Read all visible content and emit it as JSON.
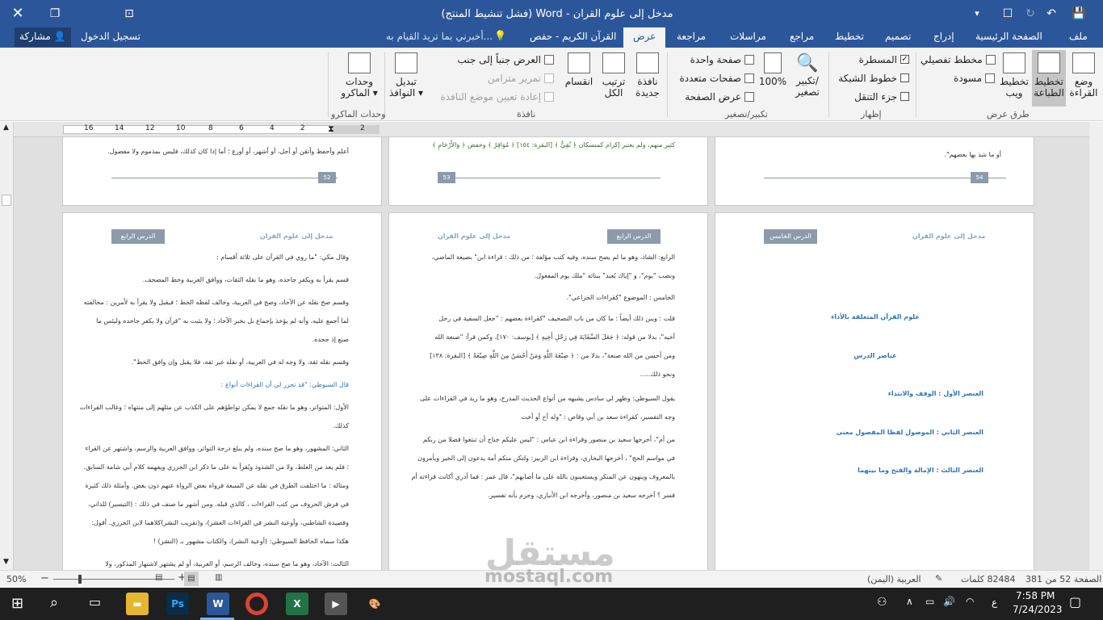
{
  "window": {
    "title": "مدخل إلى علوم القران - Word (فشل تنشيط المنتج)",
    "qat_more": "▾"
  },
  "tabs": {
    "items": [
      "ملف",
      "الصفحة الرئيسية",
      "إدراج",
      "تصميم",
      "تخطيط",
      "مراجع",
      "مراسلات",
      "مراجعة",
      "عرض",
      "القرآن الكريم - حفص"
    ],
    "tell_me": "أخبرني بما تريد القيام به...",
    "signin": "تسجيل الدخول",
    "share": "مشاركة"
  },
  "ribbon": {
    "views": {
      "label": "طرق عرض",
      "read_mode": "وضع القراءة",
      "read_mode_line1": "وضع",
      "read_mode_line2": "القراءة",
      "print_layout_line1": "تخطيط",
      "print_layout_line2": "الطباعة",
      "web_layout_line1": "تخطيط",
      "web_layout_line2": "ويب",
      "outline": "مخطط تفصيلي",
      "draft": "مسودة"
    },
    "show": {
      "label": "إظهار",
      "ruler": "المسطرة",
      "gridlines": "خطوط الشبكة",
      "nav_pane": "جزء التنقل"
    },
    "zoom": {
      "label": "تكبير/تصغير",
      "zoom_line1": "تكبير/",
      "zoom_line2": "تصغير",
      "percent": "100%",
      "one_page": "صفحة واحدة",
      "multi_page": "صفحات متعددة",
      "page_width": "عرض الصفحة"
    },
    "window": {
      "label": "نافذة",
      "new_window_line1": "نافذة",
      "new_window_line2": "جديدة",
      "arrange_line1": "ترتيب",
      "arrange_line2": "الكل",
      "split": "انقسام",
      "side_by_side": "العرض جنباً إلى جنب",
      "sync_scroll": "تمرير متزامن",
      "reset_pos": "إعادة تعيين موضع النافذة",
      "switch_line1": "تبديل",
      "switch_line2": "النوافذ"
    },
    "macros": {
      "label": "وحدات الماكرو",
      "btn_line1": "وحدات",
      "btn_line2": "الماكرو"
    }
  },
  "ruler": {
    "ticks": [
      "2",
      "2",
      "4",
      "6",
      "8",
      "10",
      "12",
      "14",
      "16"
    ]
  },
  "pages": {
    "p54": {
      "tail": "أو ما شذ بها بعضهم\".",
      "num": "54"
    },
    "p53": {
      "tail": "كثير منهم، ولم يعتبر إكرام كمنسكان ﴿ نُقِيٌّ ﴾ [البقرة: ١٥٤] ﴿ مُوَاقِرٌ ﴾ وخفض ﴿ وَالأَرْحَامِ ﴾",
      "num": "53"
    },
    "p52": {
      "tail": "أعلم وأحفظ وأتقن أو أجل، أو أشهر، أو أورع ؛ أما إذا كان كذلك، فليس بمذموم ولا مفضول.",
      "num": "52"
    },
    "p_lesson5": {
      "tag": "الدرس الخامس",
      "header": "مدخل إلى علوم القران",
      "lines": [
        "علوم القرآن المتعلقة بالأداء",
        "عناصر الدرس",
        "العنصر الأول : الوقف والابتداء",
        "العنصر الثاني : الموصول لفظا المفصول معنى",
        "العنصر الثالث : الإمالة والفتح وما بينهما"
      ]
    },
    "p_lesson4b": {
      "tag": "الدرس الرابع",
      "header": "مدخل إلى علوم القران",
      "lines": [
        "الرابع: الشاذ، وهو ما لم يصح سنده، وفيه كتب مؤلفة ؛ من ذلك : قراءة ابن\" بصيغة الماضي،",
        "ونصب \"يوم\"، و \"إياك يُعبد\" ببنائه \"ملك يوم المفعول.",
        "الخامس : الموضوع \"كقراءات الخزاعي\".",
        "قلت : ويبن ذلك أيضاً : ما كان من باب التصحيف \"كقراءة بعضهم : \"جعل السقية في رحل",
        "أخيه\"، بدلا من قوله: ﴿ جَعَلَ السِّقَايَةَ فِي رَحْلِ أَخِيهِ ﴾ [يوسف: ١٧٠]، وكمن قرأ: \"صنعة الله",
        "ومن أحسن من الله صنعة\"، بدلا من : ﴿ صِبْغَةَ اللَّهِ وَمَنْ أَحْسَنُ مِنَ اللَّهِ صِبْغَةً ﴾ [البقرة: ١٣٨]",
        "ونحو ذلك.....",
        "يقول السيوطي: وظهر لي سادس يشبهه من أنواع الحديث المدرج، وهو ما زيد في القراءات على",
        "وجه التفسير، كقراءة سعد بن أبي وقاص : \"وله أخ أو أخت",
        "من أم\"، أخرجها سعيد بن منصور وقراءة ابن عباس : \"ليس عليكم جناح أن تبتغوا فضلا من ربكم",
        "في مواسم الحج\" ، أخرجها البخاري، وقراءة ابن الزبير: ولتكن منكم أمة يدعون إلى الخير ويأمرون",
        "بالمعروف وينهون عن المنكر ويستعينون بالله على ما أصابهم\"، قال عمر : فما أدري أكانت قراءته أم",
        "فسر ؟ أخرجه سعيد بن منصور، وأخرجه ابن الأنباري، وجزم بأنه تفسير."
      ]
    },
    "p_lesson4a": {
      "tag": "الدرس الرابع",
      "header": "مدخل إلى علوم القران",
      "lines": [
        "وقال مكي: \"ما روي في القرآن على ثلاثة أقسام :",
        "قسم يقرأ به ويكفر جاحده، وهو ما نقله الثقات، ووافق العربية وخط المصحف.",
        "وقسم صح نقله عن الآحاد، وصح في العربية، وخالف لفظه الخط ؛ فيقبل ولا يقرأ به لأمرين : مخالفته",
        "لما أجمع عليه، وأنه لم يؤخذ بإجماع بل بخبر الآحاد ؛ ولا يثبت به \"قرآن ولا يكفر جاحده وليئس ما",
        "صنع إذ جحده.",
        "وقسم نقله ثقة، ولا وجه له في العربية، أو نقله غير ثقة، فلا يقبل وإن وافق الخط\".",
        "قال السيوطي: \"قد تحرر لي أن القراءات أنواع :",
        "الأول: المتواتر، وهو ما نقله جمع لا يمكن تواطؤهم على الكذب عن مثلهم إلى منتهاه ؛ وغالب القراءات",
        "كذلك.",
        "الثاني: المشهور، وهو ما صح سنده، ولم يبلغ درجة التواتر، ووافق العربية والرسم، واشتهر عن القراء",
        "؛ فلم يعد من الغلط، ولا من الشذوذ ويُقرأ به على ما ذكر ابن الجزري ويفهمه كلام أبي شامة السابق.",
        "ومثاله : ما اختلفت الطرق في نقله عن السبعة فرواه بعض الرواة عنهم دون بعض. وأمثلة ذلك كثيرة",
        "في فرش الحروف من كتب القراءات ، كالذي قبله. ومن أشهر ما صنف في ذلك : (التيسير) للداني،",
        "وقصيدة الشاطبي، وأوعية النشر في القراءات العشر)، و(تقريب النشر)كلاهما لابن الجزري. أقول:",
        "هكذا سماه الحافظ السيوطي: (أوعية النشر)، والكتاب مشهور بـ (النشر) !",
        "الثالث: الآحاد، وهو ما صح سنده، وخالف الرسم، أو العربية، أو لم يشتهر لاشتهار المذكور، ولا"
      ]
    }
  },
  "status": {
    "page": "الصفحة 52 من 381",
    "words": "82484 كلمات",
    "language": "العربية (اليمن)",
    "zoom": "50%",
    "zoom_level": 0.5
  },
  "taskbar": {
    "time": "7:58 PM",
    "date": "7/24/2023",
    "lang": "ع"
  },
  "watermark": {
    "arabic": "مستقل",
    "latin": "mostaql.com"
  },
  "colors": {
    "accent": "#2b579a",
    "page_tag": "#8c9bab",
    "heading_blue": "#2e74b5"
  }
}
